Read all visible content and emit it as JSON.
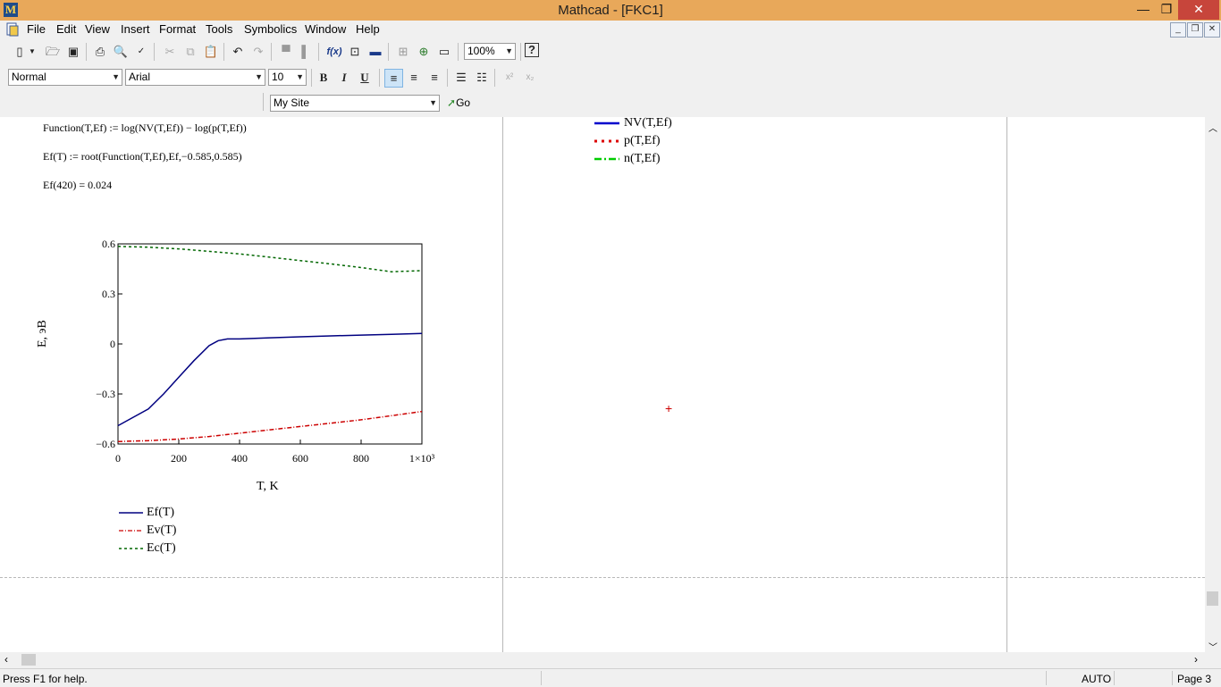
{
  "window": {
    "title": "Mathcad - [FKC1]",
    "app_logo_letter": "M",
    "minimize": "—",
    "restore": "❐",
    "close": "✕"
  },
  "menu": [
    "File",
    "Edit",
    "View",
    "Insert",
    "Format",
    "Tools",
    "Symbolics",
    "Window",
    "Help"
  ],
  "toolbar": {
    "zoom": "100%",
    "style": "Normal",
    "font": "Arial",
    "font_size": "10",
    "bold": "B",
    "italic": "I",
    "underline": "U",
    "resource_site": "My Site",
    "go_label": "Go"
  },
  "worksheet": {
    "eq1": "Function(T,Ef) := log(NV(T,Ef)) − log(p(T,Ef))",
    "eq2": "Ef(T) := root(Function(T,Ef),Ef,−0.585,0.585)",
    "eq3": "Ef(420) = 0.024",
    "right_legend": [
      {
        "label": "NV(T,Ef)",
        "color": "#0000cc",
        "style": "solid"
      },
      {
        "label": "p(T,Ef)",
        "color": "#dd0000",
        "style": "dotted"
      },
      {
        "label": "n(T,Ef)",
        "color": "#00cc00",
        "style": "dashdot"
      }
    ]
  },
  "chart_data": {
    "type": "line",
    "xlabel": "T, K",
    "ylabel": "E, эВ",
    "xlim": [
      0,
      1000
    ],
    "ylim": [
      -0.6,
      0.6
    ],
    "xticks": [
      "0",
      "200",
      "400",
      "600",
      "800",
      "1×10³"
    ],
    "yticks": [
      "0.6",
      "0.3",
      "0",
      "−0.3",
      "−0.6"
    ],
    "series": [
      {
        "name": "Ef(T)",
        "color": "#000080",
        "style": "solid",
        "x": [
          0,
          50,
          100,
          150,
          200,
          250,
          300,
          330,
          360,
          400,
          500,
          600,
          700,
          800,
          900,
          1000
        ],
        "y": [
          -0.49,
          -0.44,
          -0.39,
          -0.3,
          -0.2,
          -0.1,
          -0.01,
          0.02,
          0.03,
          0.03,
          0.037,
          0.043,
          0.048,
          0.053,
          0.058,
          0.063
        ]
      },
      {
        "name": "Ev(T)",
        "color": "#cc0000",
        "style": "dashdot",
        "x": [
          0,
          100,
          200,
          300,
          400,
          500,
          600,
          700,
          800,
          900,
          1000
        ],
        "y": [
          -0.585,
          -0.58,
          -0.57,
          -0.555,
          -0.535,
          -0.515,
          -0.495,
          -0.475,
          -0.455,
          -0.43,
          -0.405
        ]
      },
      {
        "name": "Ec(T)",
        "color": "#006600",
        "style": "dashed",
        "x": [
          0,
          100,
          200,
          300,
          400,
          500,
          600,
          700,
          800,
          900,
          1000
        ],
        "y": [
          0.585,
          0.58,
          0.57,
          0.555,
          0.54,
          0.52,
          0.5,
          0.48,
          0.458,
          0.433,
          0.44
        ]
      }
    ]
  },
  "status": {
    "help": "Press F1 for help.",
    "mode": "AUTO",
    "page": "Page 3"
  }
}
